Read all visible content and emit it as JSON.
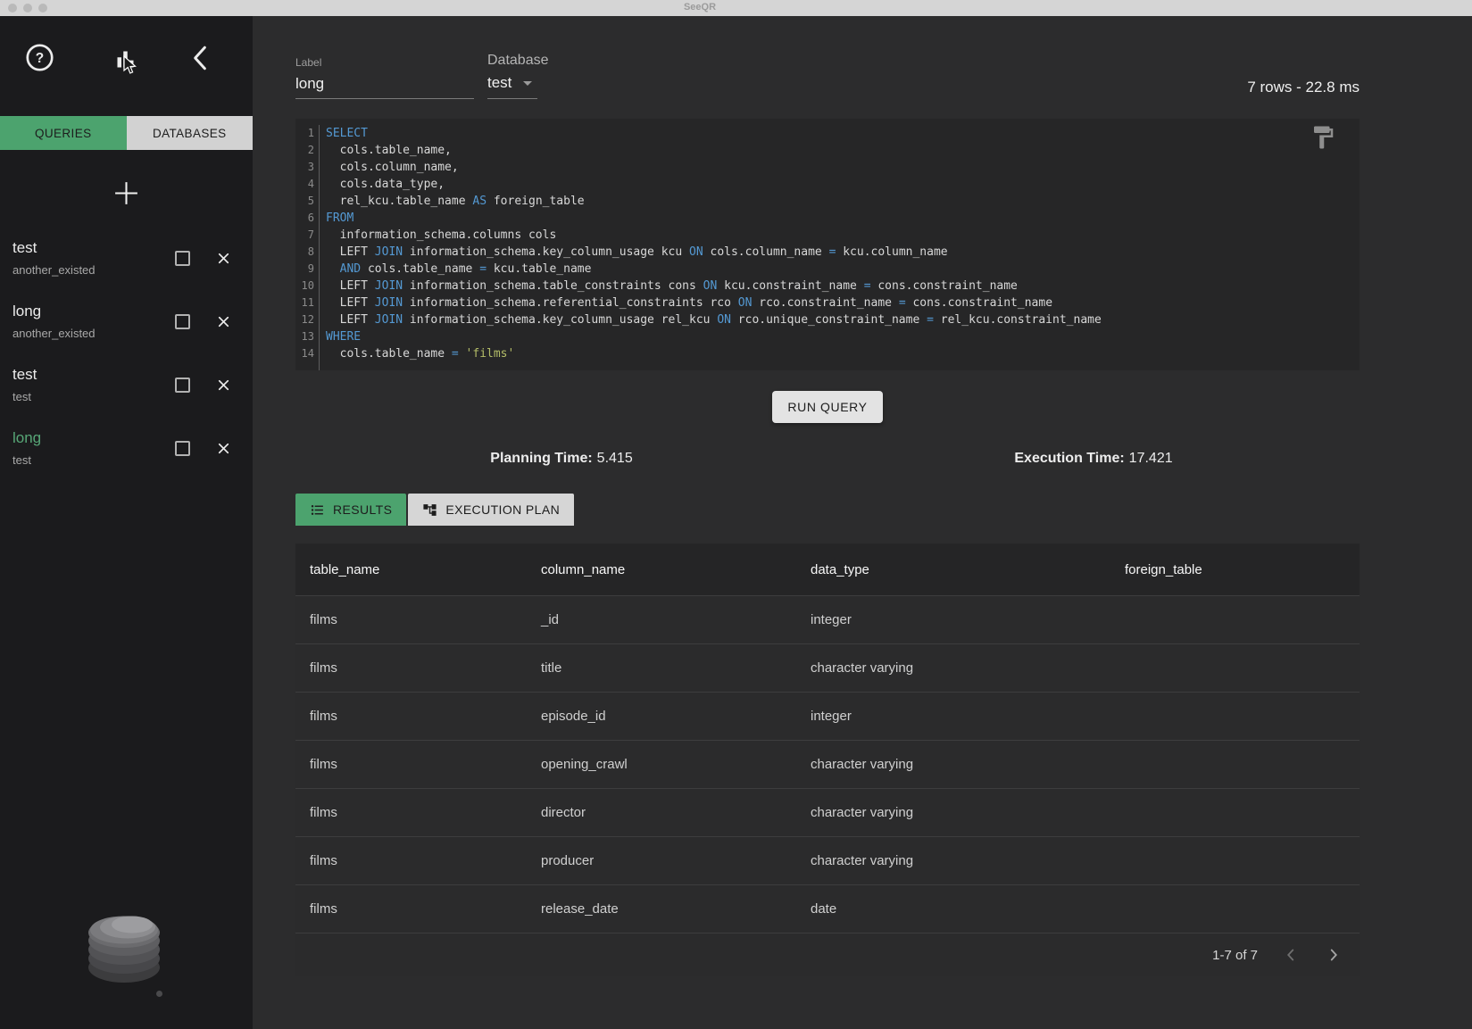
{
  "colors": {
    "accent_green": "#4ca36e",
    "selected_green": "#57a777",
    "keyword_blue": "#5499d3",
    "string_yellow": "#b4bd68"
  },
  "titlebar": {
    "title": "SeeQR"
  },
  "sidebar": {
    "tabs": {
      "queries": "QUERIES",
      "databases": "DATABASES"
    },
    "items": [
      {
        "label": "test",
        "db": "another_existed",
        "selected": false
      },
      {
        "label": "long",
        "db": "another_existed",
        "selected": false
      },
      {
        "label": "test",
        "db": "test",
        "selected": false
      },
      {
        "label": "long",
        "db": "test",
        "selected": true
      }
    ]
  },
  "query_header": {
    "label_caption": "Label",
    "label_value": "long",
    "database_caption": "Database",
    "database_value": "test",
    "result_stats": "7 rows - 22.8 ms"
  },
  "editor": {
    "lines": [
      {
        "n": 1,
        "t": [
          [
            "kw",
            "SELECT"
          ]
        ]
      },
      {
        "n": 2,
        "t": [
          [
            "pl",
            "  cols.table_name,"
          ]
        ]
      },
      {
        "n": 3,
        "t": [
          [
            "pl",
            "  cols.column_name,"
          ]
        ]
      },
      {
        "n": 4,
        "t": [
          [
            "pl",
            "  cols.data_type,"
          ]
        ]
      },
      {
        "n": 5,
        "t": [
          [
            "pl",
            "  rel_kcu.table_name "
          ],
          [
            "kw",
            "AS"
          ],
          [
            "pl",
            " foreign_table"
          ]
        ]
      },
      {
        "n": 6,
        "t": [
          [
            "kw",
            "FROM"
          ]
        ]
      },
      {
        "n": 7,
        "t": [
          [
            "pl",
            "  information_schema.columns cols"
          ]
        ]
      },
      {
        "n": 8,
        "t": [
          [
            "pl",
            "  LEFT "
          ],
          [
            "kw",
            "JOIN"
          ],
          [
            "pl",
            " information_schema.key_column_usage kcu "
          ],
          [
            "kw",
            "ON"
          ],
          [
            "pl",
            " cols.column_name "
          ],
          [
            "op",
            "="
          ],
          [
            "pl",
            " kcu.column_name"
          ]
        ]
      },
      {
        "n": 9,
        "t": [
          [
            "pl",
            "  "
          ],
          [
            "kw",
            "AND"
          ],
          [
            "pl",
            " cols.table_name "
          ],
          [
            "op",
            "="
          ],
          [
            "pl",
            " kcu.table_name"
          ]
        ]
      },
      {
        "n": 10,
        "t": [
          [
            "pl",
            "  LEFT "
          ],
          [
            "kw",
            "JOIN"
          ],
          [
            "pl",
            " information_schema.table_constraints cons "
          ],
          [
            "kw",
            "ON"
          ],
          [
            "pl",
            " kcu.constraint_name "
          ],
          [
            "op",
            "="
          ],
          [
            "pl",
            " cons.constraint_name"
          ]
        ]
      },
      {
        "n": 11,
        "t": [
          [
            "pl",
            "  LEFT "
          ],
          [
            "kw",
            "JOIN"
          ],
          [
            "pl",
            " information_schema.referential_constraints rco "
          ],
          [
            "kw",
            "ON"
          ],
          [
            "pl",
            " rco.constraint_name "
          ],
          [
            "op",
            "="
          ],
          [
            "pl",
            " cons.constraint_name"
          ]
        ]
      },
      {
        "n": 12,
        "t": [
          [
            "pl",
            "  LEFT "
          ],
          [
            "kw",
            "JOIN"
          ],
          [
            "pl",
            " information_schema.key_column_usage rel_kcu "
          ],
          [
            "kw",
            "ON"
          ],
          [
            "pl",
            " rco.unique_constraint_name "
          ],
          [
            "op",
            "="
          ],
          [
            "pl",
            " rel_kcu.constraint_name"
          ]
        ]
      },
      {
        "n": 13,
        "t": [
          [
            "kw",
            "WHERE"
          ]
        ]
      },
      {
        "n": 14,
        "t": [
          [
            "pl",
            "  cols.table_name "
          ],
          [
            "op",
            "="
          ],
          [
            "pl",
            " "
          ],
          [
            "str",
            "'films'"
          ]
        ]
      }
    ]
  },
  "run_button_label": "RUN QUERY",
  "timing": {
    "planning_label": "Planning Time:",
    "planning_value": "5.415",
    "execution_label": "Execution Time:",
    "execution_value": "17.421"
  },
  "result_tabs": {
    "results": "RESULTS",
    "execution_plan": "EXECUTION PLAN"
  },
  "results_table": {
    "headers": [
      "table_name",
      "column_name",
      "data_type",
      "foreign_table"
    ],
    "rows": [
      [
        "films",
        "_id",
        "integer",
        ""
      ],
      [
        "films",
        "title",
        "character varying",
        ""
      ],
      [
        "films",
        "episode_id",
        "integer",
        ""
      ],
      [
        "films",
        "opening_crawl",
        "character varying",
        ""
      ],
      [
        "films",
        "director",
        "character varying",
        ""
      ],
      [
        "films",
        "producer",
        "character varying",
        ""
      ],
      [
        "films",
        "release_date",
        "date",
        ""
      ]
    ],
    "pagination": "1-7 of 7"
  }
}
